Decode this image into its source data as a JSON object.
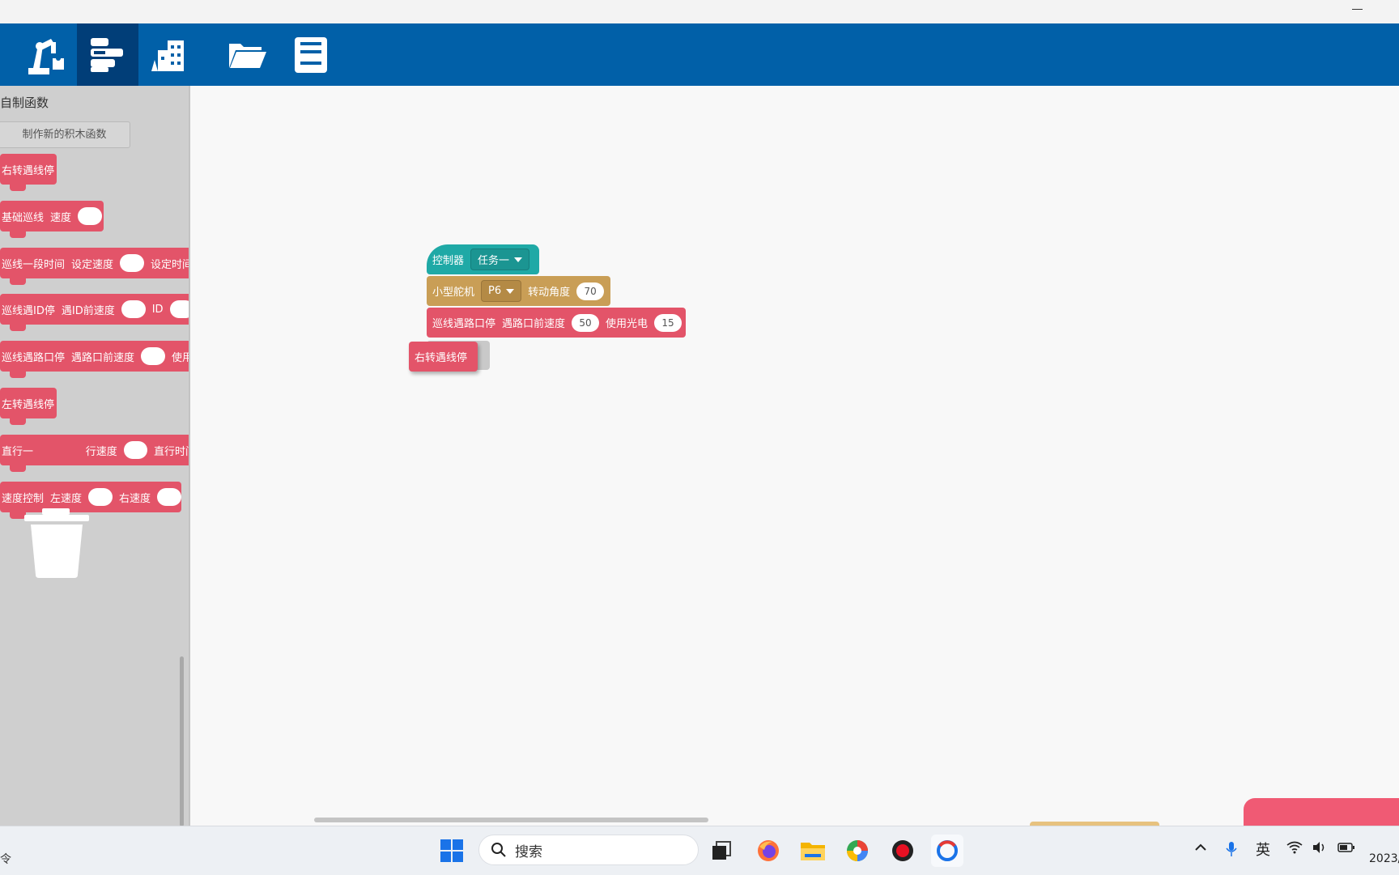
{
  "sidebar": {
    "title": "自制函数",
    "make_button": "制作新的积木函数",
    "blocks": [
      {
        "label": "右转遇线停"
      },
      {
        "label": "基础巡线",
        "p1": "速度"
      },
      {
        "label": "巡线一段时间",
        "p1": "设定速度",
        "p2": "设定时间"
      },
      {
        "label": "巡线遇ID停",
        "p1": "遇ID前速度",
        "p2": "ID"
      },
      {
        "label": "巡线遇路口停",
        "p1": "遇路口前速度",
        "p2": "使用"
      },
      {
        "label": "左转遇线停"
      },
      {
        "label": "直行一",
        "p1": "行速度",
        "p2": "直行时间"
      },
      {
        "label": "速度控制",
        "p1": "左速度",
        "p2": "右速度"
      }
    ]
  },
  "workspace": {
    "controller": {
      "label": "控制器",
      "task": "任务一"
    },
    "servo": {
      "label": "小型舵机",
      "port": "P6",
      "angle_label": "转动角度",
      "angle": "70"
    },
    "line_stop": {
      "label": "巡线遇路口停",
      "speed_label": "遇路口前速度",
      "speed": "50",
      "sensor_label": "使用光电",
      "sensor": "15"
    },
    "dragging": {
      "label": "右转遇线停"
    }
  },
  "taskbar": {
    "left_fragment": "令",
    "search_placeholder": "搜索",
    "ime": "英",
    "clock": "2023/"
  },
  "colors": {
    "toolbar": "#0160a8",
    "teal": "#1fa9a6",
    "tan": "#c99e56",
    "red": "#e35469"
  }
}
